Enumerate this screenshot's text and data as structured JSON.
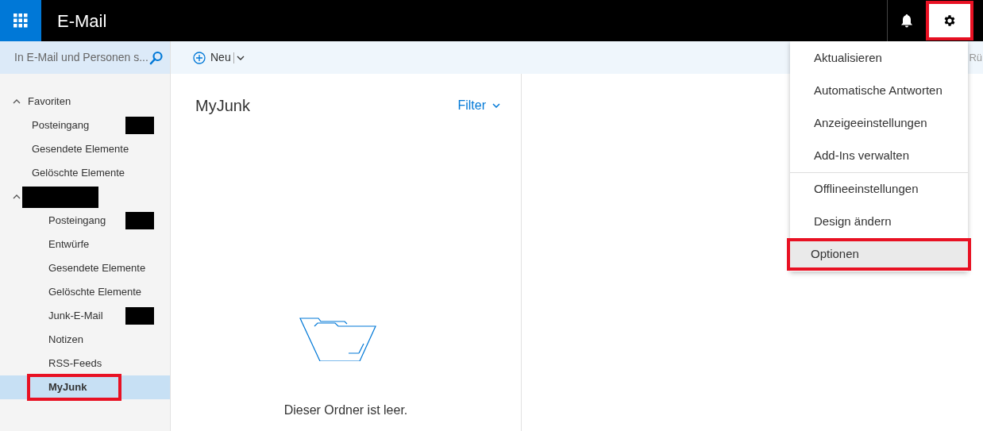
{
  "header": {
    "title": "E-Mail",
    "settings_highlighted": true
  },
  "search": {
    "placeholder": "In E-Mail und Personen s..."
  },
  "toolbar": {
    "new_label": "Neu",
    "cut_text": "Rü"
  },
  "sidebar": {
    "groups": [
      {
        "label": "Favoriten",
        "label_redacted": false,
        "expanded": true,
        "items": [
          {
            "label": "Posteingang",
            "selected": false,
            "highlighted": false,
            "redacted_count": true
          },
          {
            "label": "Gesendete Elemente",
            "selected": false,
            "highlighted": false,
            "redacted_count": false
          },
          {
            "label": "Gelöschte Elemente",
            "selected": false,
            "highlighted": false,
            "redacted_count": false
          }
        ]
      },
      {
        "label_redacted": true,
        "expanded": true,
        "items": [
          {
            "label": "Posteingang",
            "selected": false,
            "highlighted": false,
            "redacted_count": true
          },
          {
            "label": "Entwürfe",
            "selected": false,
            "highlighted": false,
            "redacted_count": false
          },
          {
            "label": "Gesendete Elemente",
            "selected": false,
            "highlighted": false,
            "redacted_count": false
          },
          {
            "label": "Gelöschte Elemente",
            "selected": false,
            "highlighted": false,
            "redacted_count": false
          },
          {
            "label": "Junk-E-Mail",
            "selected": false,
            "highlighted": false,
            "redacted_count": true
          },
          {
            "label": "Notizen",
            "selected": false,
            "highlighted": false,
            "redacted_count": false
          },
          {
            "label": "RSS-Feeds",
            "selected": false,
            "highlighted": false,
            "redacted_count": false
          },
          {
            "label": "MyJunk",
            "selected": true,
            "highlighted": true,
            "redacted_count": false
          }
        ]
      }
    ]
  },
  "message_list": {
    "title": "MyJunk",
    "filter": "Filter",
    "empty_text": "Dieser Ordner ist leer."
  },
  "settings_menu": {
    "items": [
      {
        "label": "Aktualisieren",
        "hovered": false,
        "highlighted": false,
        "divider_after": false
      },
      {
        "label": "Automatische Antworten",
        "hovered": false,
        "highlighted": false,
        "divider_after": false
      },
      {
        "label": "Anzeigeeinstellungen",
        "hovered": false,
        "highlighted": false,
        "divider_after": false
      },
      {
        "label": "Add-Ins verwalten",
        "hovered": false,
        "highlighted": false,
        "divider_after": true
      },
      {
        "label": "Offlineeinstellungen",
        "hovered": false,
        "highlighted": false,
        "divider_after": false
      },
      {
        "label": "Design ändern",
        "hovered": false,
        "highlighted": false,
        "divider_after": false
      },
      {
        "label": "Optionen",
        "hovered": true,
        "highlighted": true,
        "divider_after": false
      }
    ]
  }
}
